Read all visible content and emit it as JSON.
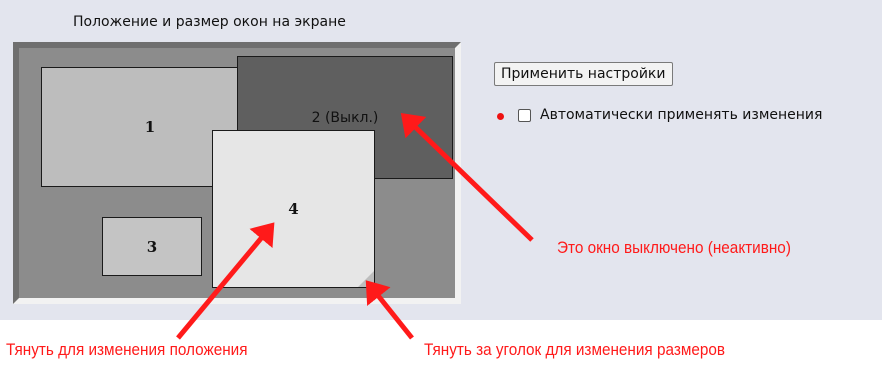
{
  "panel": {
    "title": "Положение и размер окон на экране"
  },
  "windows": [
    {
      "id": "1",
      "label": "1",
      "state": "active"
    },
    {
      "id": "2",
      "label": "2 (Выкл.)",
      "state": "disabled"
    },
    {
      "id": "3",
      "label": "3",
      "state": "active"
    },
    {
      "id": "4",
      "label": "4",
      "state": "active"
    }
  ],
  "controls": {
    "apply_button": "Применить настройки",
    "auto_apply_label": "Автоматически применять изменения",
    "auto_apply_checked": false,
    "indicator_color": "#ee1111"
  },
  "annotations": {
    "disabled_window": "Это окно выключено (неактивно)",
    "drag_move": "Тянуть для изменения положения",
    "drag_resize": "Тянуть за уголок для изменения размеров",
    "color": "#ff1a1a"
  }
}
